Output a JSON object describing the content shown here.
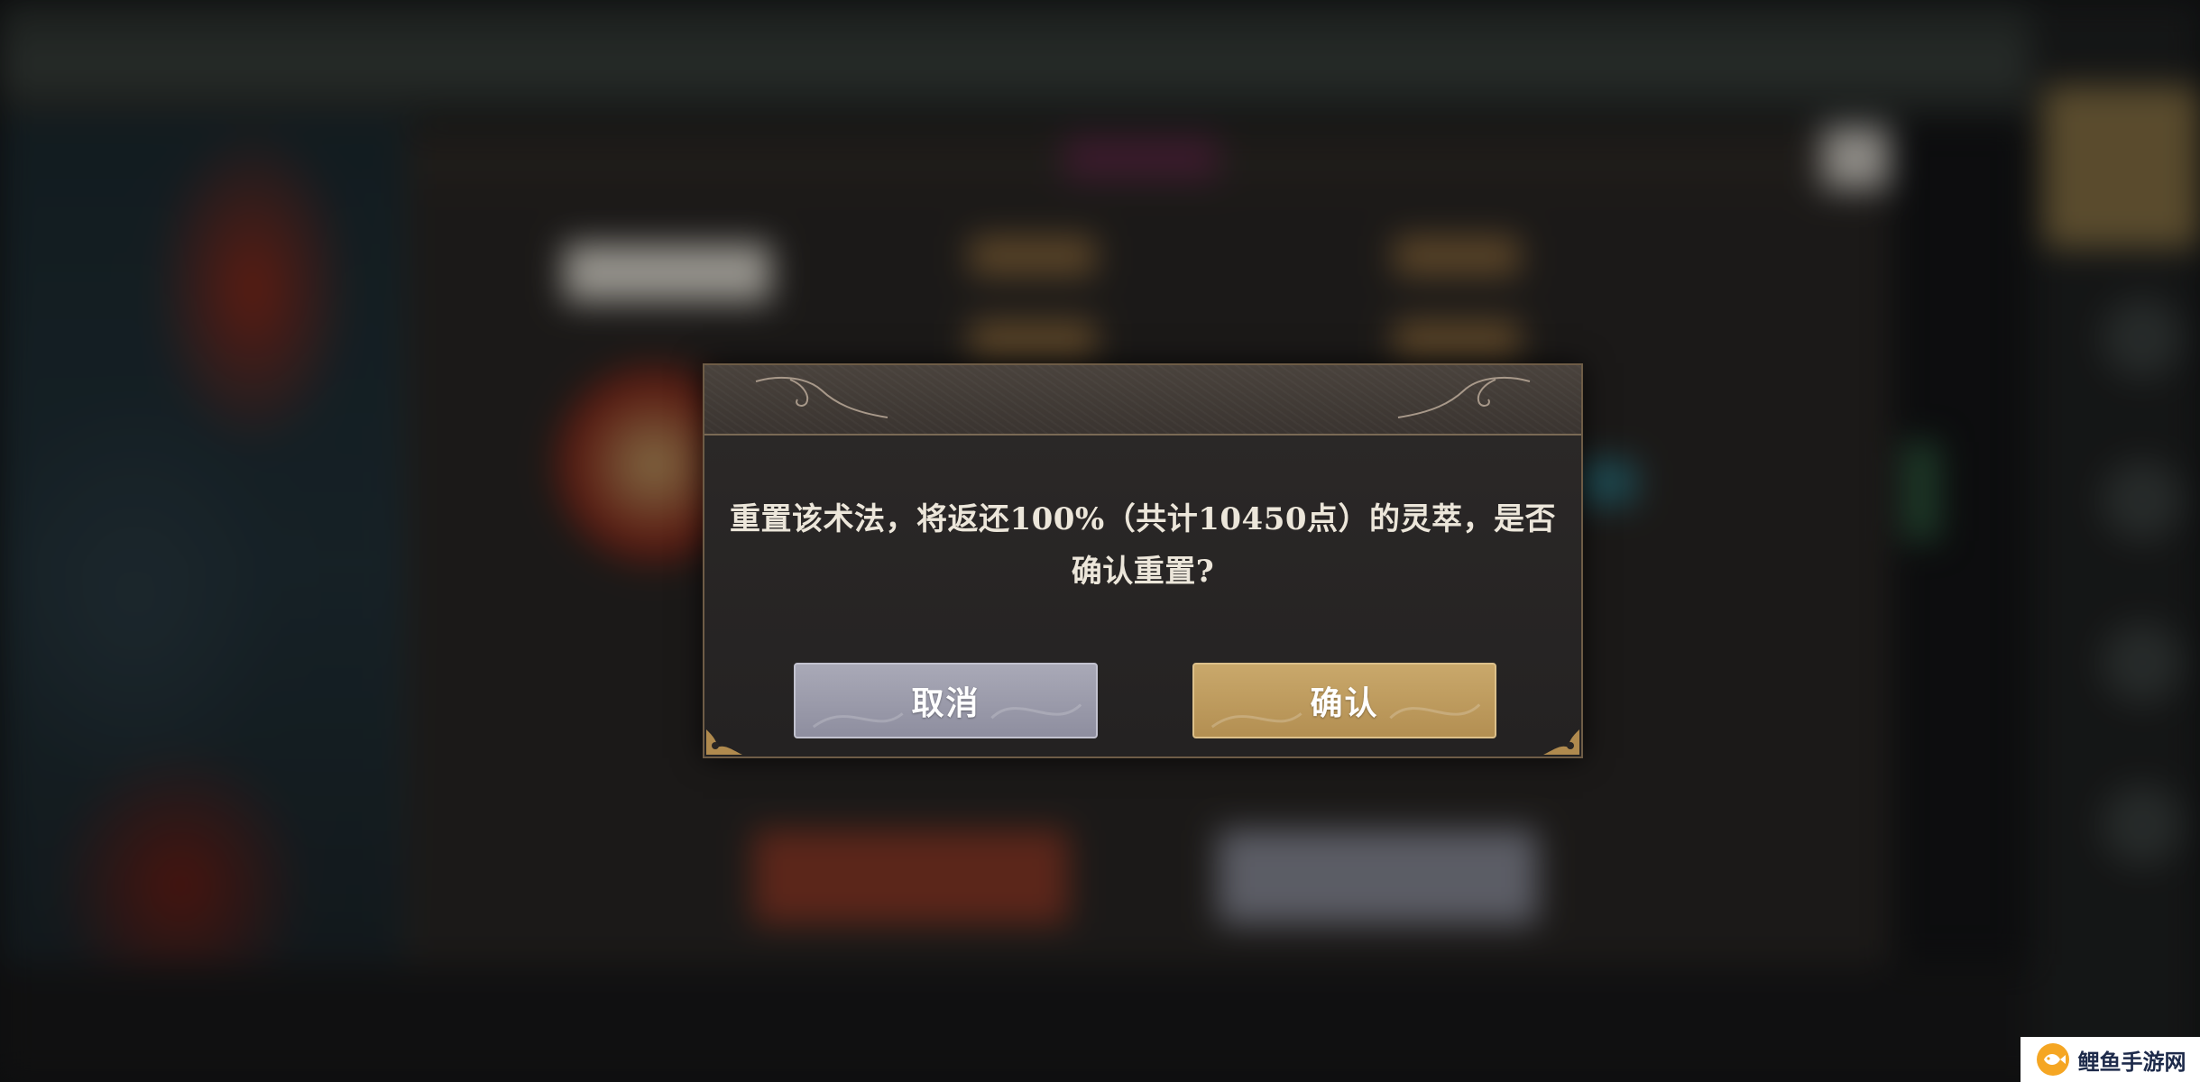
{
  "dialog": {
    "message_line1": "重置该术法，将返还100%（共计10450点）的灵萃，是否",
    "message_line2": "确认重置?",
    "cancel_label": "取消",
    "confirm_label": "确认"
  },
  "watermark": {
    "text": "鲤鱼手游网"
  },
  "colors": {
    "dialog_bg": "#262423",
    "dialog_border": "#6e5c46",
    "cancel_button": "#9a9aaa",
    "confirm_button": "#bf9c5e",
    "message_text": "#ece6da"
  }
}
